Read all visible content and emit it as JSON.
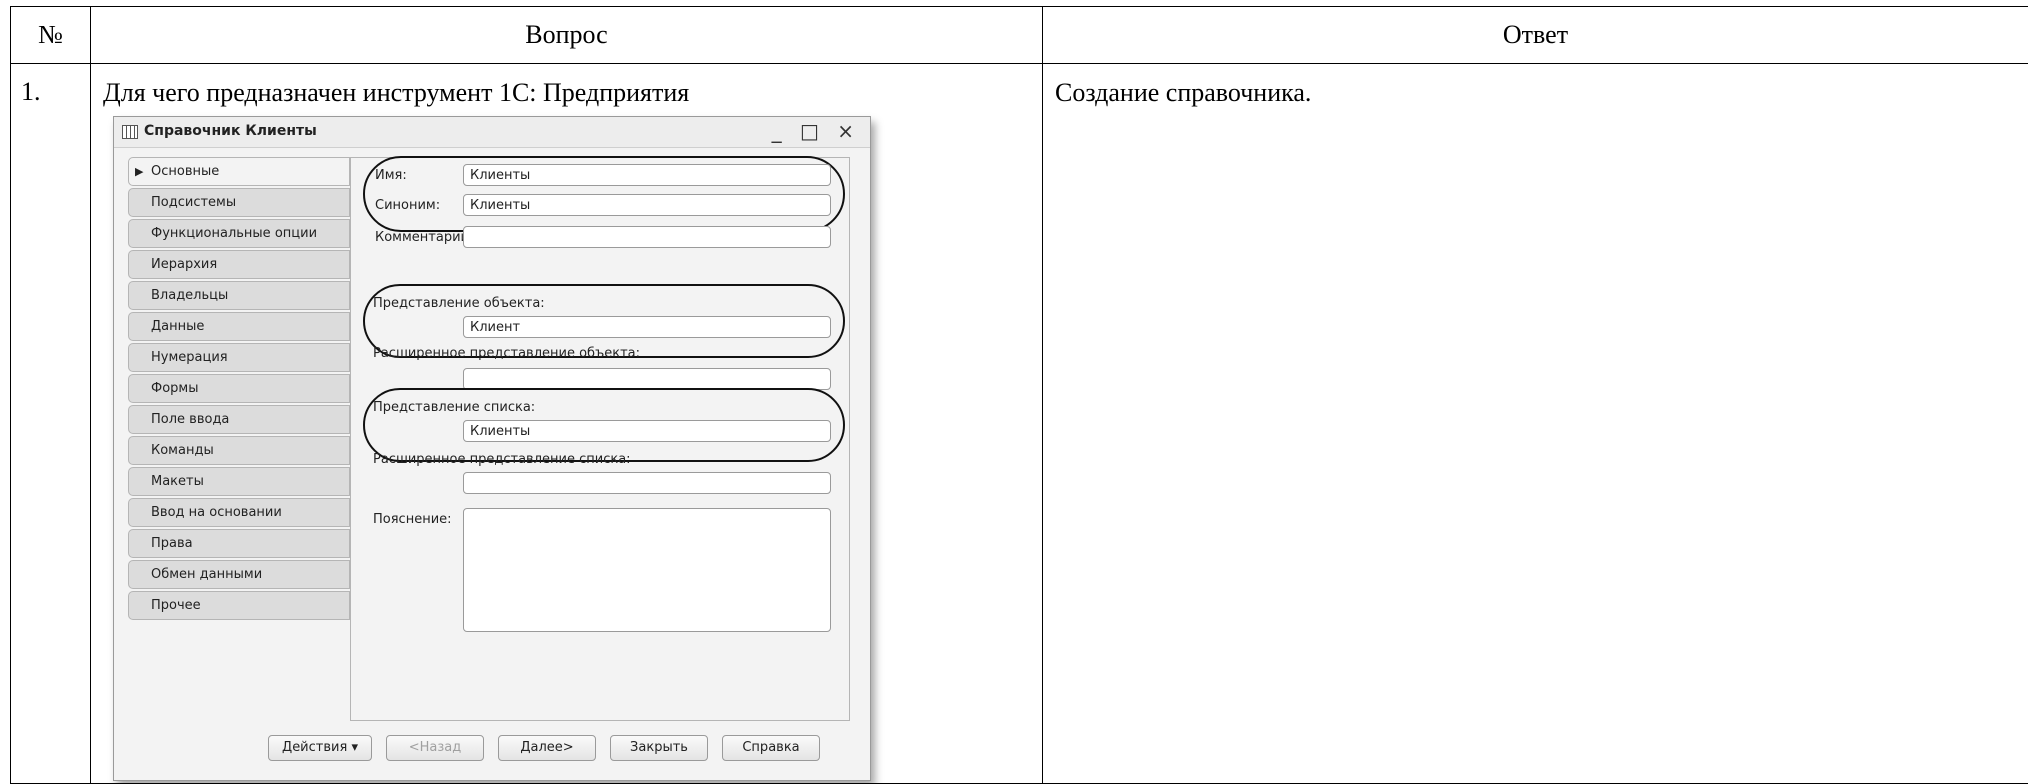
{
  "table": {
    "headers": {
      "num": "№",
      "question": "Вопрос",
      "answer": "Ответ"
    },
    "rows": [
      {
        "num": "1.",
        "question": "Для чего предназначен инструмент 1С: Предприятия",
        "answer": "Создание справочника."
      }
    ]
  },
  "window": {
    "title": "Справочник Клиенты",
    "controls": "_ □ ×",
    "tabs": [
      {
        "label": "Основные",
        "active": true
      },
      {
        "label": "Подсистемы"
      },
      {
        "label": "Функциональные опции"
      },
      {
        "label": "Иерархия"
      },
      {
        "label": "Владельцы"
      },
      {
        "label": "Данные"
      },
      {
        "label": "Нумерация"
      },
      {
        "label": "Формы"
      },
      {
        "label": "Поле ввода"
      },
      {
        "label": "Команды"
      },
      {
        "label": "Макеты"
      },
      {
        "label": "Ввод на основании"
      },
      {
        "label": "Права"
      },
      {
        "label": "Обмен данными"
      },
      {
        "label": "Прочее"
      }
    ],
    "fields": {
      "name_label": "Имя:",
      "name_value": "Клиенты",
      "synonym_label": "Синоним:",
      "synonym_value": "Клиенты",
      "comment_label": "Комментарий:",
      "comment_value": "",
      "object_repr_label": "Представление объекта:",
      "object_repr_value": "Клиент",
      "ext_object_repr_label": "Расширенное представление объекта:",
      "ext_object_repr_value": "",
      "list_repr_label": "Представление списка:",
      "list_repr_value": "Клиенты",
      "ext_list_repr_label": "Расширенное представление списка:",
      "ext_list_repr_value": "",
      "explanation_label": "Пояснение:",
      "explanation_value": ""
    },
    "buttons": {
      "actions": "Действия",
      "actions_arrow": "▾",
      "back": "<Назад",
      "next": "Далее>",
      "close": "Закрыть",
      "help": "Справка"
    }
  }
}
